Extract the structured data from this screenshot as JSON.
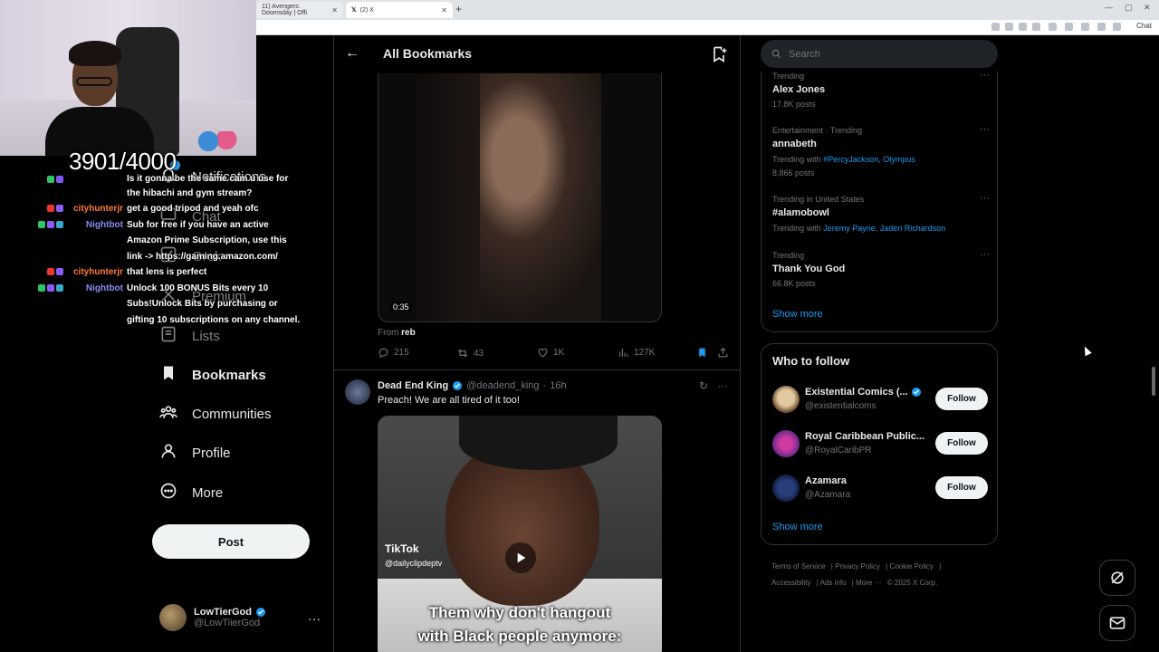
{
  "browser": {
    "tab1_title": "11) Avengers: Doomsday | Offi",
    "tab2_title": "(2) X",
    "chat_label": "Chat"
  },
  "stream": {
    "counter": "3901/4000",
    "chat": [
      {
        "user": "",
        "msg": "Is it gonna be the same cam u use for the hibachi and gym stream?"
      },
      {
        "user": "cityhunterjr",
        "msg": "get a good tripod and yeah ofc",
        "color": "#ff7a3a"
      },
      {
        "user": "Nightbot",
        "msg": "Sub for free if you have an active Amazon Prime Subscription, use this link -> https://gaming.amazon.com/",
        "color": "#8a8cf0"
      },
      {
        "user": "cityhunterjr",
        "msg": "that lens is perfect",
        "color": "#ff7a3a"
      },
      {
        "user": "Nightbot",
        "msg": "Unlock 100 BONUS Bits every 10 Subs!Unlock Bits by purchasing or gifting 10 subscriptions on any channel.",
        "color": "#8a8cf0"
      }
    ]
  },
  "nav": {
    "notifications": "Notifications",
    "notifications_badge": "1",
    "chat": "Chat",
    "grok": "Grok",
    "premium": "Premium",
    "lists": "Lists",
    "bookmarks": "Bookmarks",
    "communities": "Communities",
    "profile": "Profile",
    "more": "More",
    "post": "Post"
  },
  "account": {
    "name": "LowTierGod",
    "handle": "@LowTiierGod"
  },
  "main": {
    "title": "All Bookmarks",
    "post1": {
      "duration": "0:35",
      "from_label": "From",
      "from_user": "reb",
      "replies": "215",
      "reposts": "43",
      "likes": "1K",
      "views": "127K"
    },
    "post2": {
      "name": "Dead End King",
      "handle": "@deadend_king",
      "time": "16h",
      "text": "Preach! We are all tired of it too!",
      "tiktok": "TikTok",
      "tiktok_handle": "@dailyclipdeptv",
      "caption1": "Them why don't hangout",
      "caption2": "with Black people anymore:"
    }
  },
  "right": {
    "search_placeholder": "Search",
    "trends": [
      {
        "category": "Trending",
        "name": "Alex Jones",
        "count": "17.8K posts"
      },
      {
        "category": "Entertainment · Trending",
        "name": "annabeth",
        "with": [
          "#PercyJackson",
          "Olympus"
        ],
        "count": "8,866 posts"
      },
      {
        "category": "Trending in United States",
        "name": "#alamobowl",
        "with": [
          "Jeremy Payne",
          "Jaden Richardson"
        ]
      },
      {
        "category": "Trending",
        "name": "Thank You God",
        "count": "66.8K posts"
      }
    ],
    "trending_with_label": "Trending with",
    "show_more": "Show more",
    "who_to_follow": "Who to follow",
    "follow_label": "Follow",
    "follows": [
      {
        "name": "Existential Comics (...",
        "handle": "@existentialcoms"
      },
      {
        "name": "Royal Caribbean Public...",
        "handle": "@RoyalCaribPR"
      },
      {
        "name": "Azamara",
        "handle": "@Azamara"
      }
    ],
    "footer": [
      "Terms of Service",
      "Privacy Policy",
      "Cookie Policy",
      "Accessibility",
      "Ads info",
      "More ···",
      "© 2025 X Corp."
    ]
  }
}
